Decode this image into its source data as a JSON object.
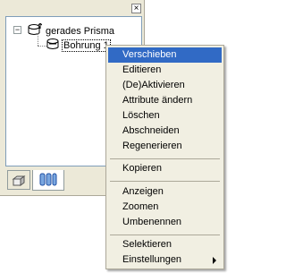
{
  "panel": {
    "close_glyph": "×",
    "tree": {
      "root": {
        "label": "gerades Prisma",
        "expander": "−",
        "icon": "prism-icon"
      },
      "child": {
        "label": "Bohrung 1",
        "icon": "bore-icon"
      }
    },
    "tabs": [
      {
        "name": "tab-model",
        "icon": "model-icon"
      },
      {
        "name": "tab-features",
        "icon": "features-icon"
      }
    ]
  },
  "context_menu": {
    "items": [
      {
        "label": "Verschieben",
        "highlighted": true
      },
      {
        "label": "Editieren"
      },
      {
        "label": "(De)Aktivieren"
      },
      {
        "label": "Attribute ändern"
      },
      {
        "label": "Löschen"
      },
      {
        "label": "Abschneiden"
      },
      {
        "label": "Regenerieren"
      },
      {
        "label": "Kopieren"
      },
      {
        "label": "Anzeigen"
      },
      {
        "label": "Zoomen"
      },
      {
        "label": "Umbenennen"
      },
      {
        "label": "Selektieren"
      },
      {
        "label": "Einstellungen",
        "submenu": true
      }
    ]
  },
  "colors": {
    "panel_bg": "#ece9d8",
    "menu_bg": "#f1efe2",
    "highlight": "#316ac5"
  }
}
